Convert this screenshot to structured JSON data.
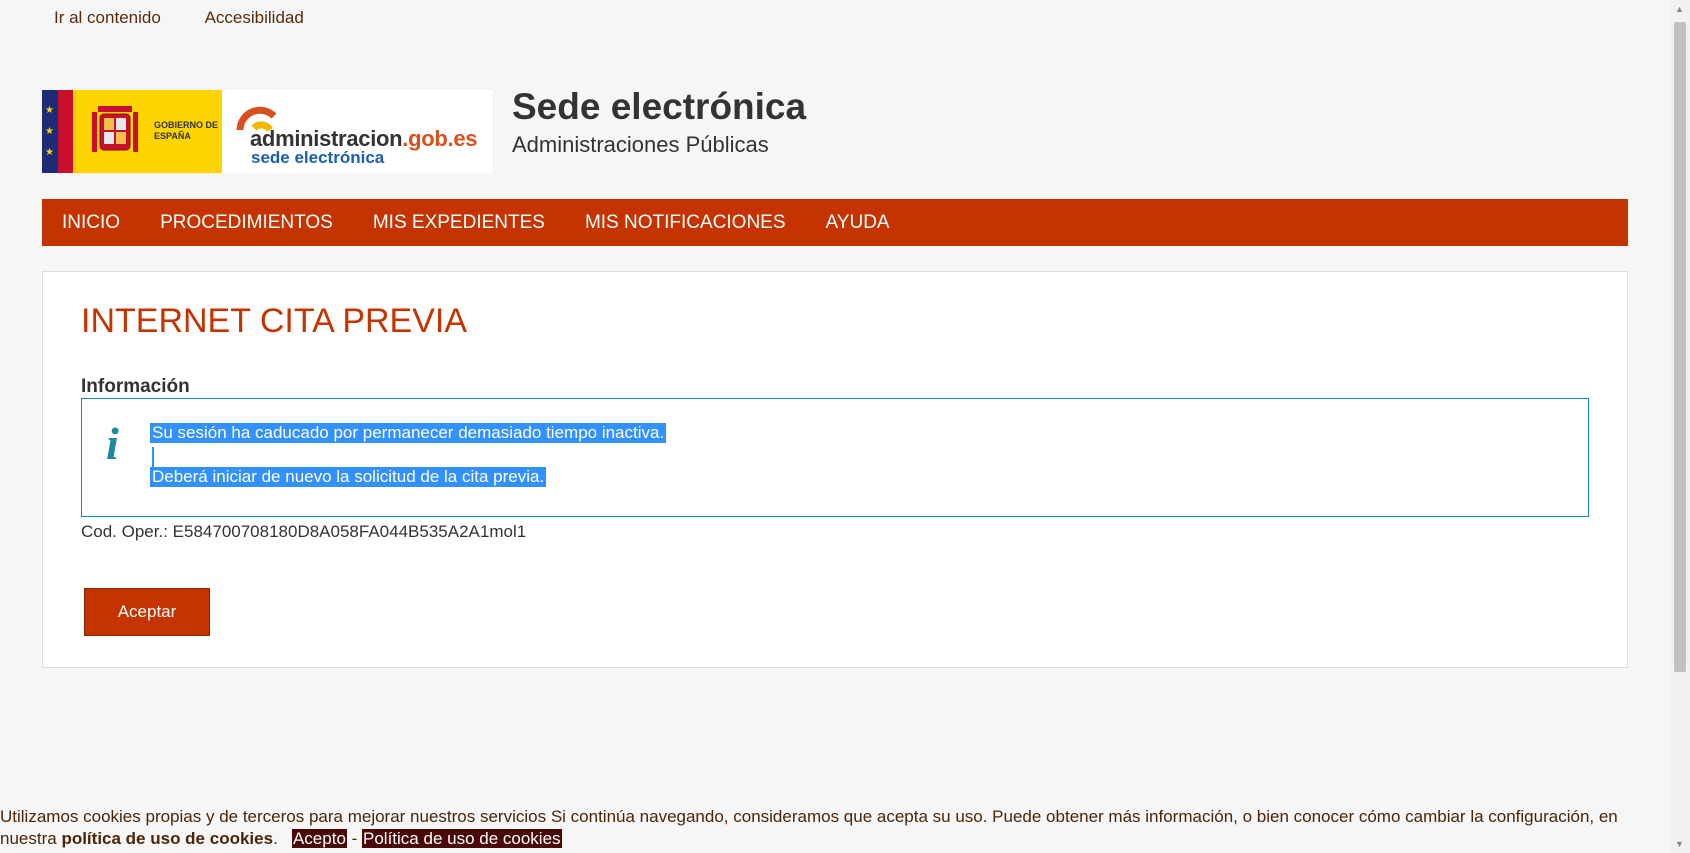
{
  "skip_links": {
    "content": "Ir al contenido",
    "accessibility": "Accesibilidad"
  },
  "header": {
    "gobierno_logo": "GOBIERNO DE ESPAÑA",
    "admin_logo_main": "administracion",
    "admin_logo_domain": ".gob.es",
    "admin_logo_sub": "sede electrónica",
    "title": "Sede electrónica",
    "subtitle": "Administraciones Públicas"
  },
  "nav": {
    "items": [
      "INICIO",
      "PROCEDIMIENTOS",
      "MIS EXPEDIENTES",
      "MIS NOTIFICACIONES",
      "AYUDA"
    ]
  },
  "main": {
    "page_title": "INTERNET CITA PREVIA",
    "info_label": "Información",
    "info_icon": "info-icon",
    "messages": [
      "Su sesión ha caducado por permanecer demasiado tiempo inactiva.",
      "Deberá iniciar de nuevo la solicitud de la cita previa."
    ],
    "cod_oper": "Cod. Oper.: E584700708180D8A058FA044B535A2A1mol1",
    "accept_button": "Aceptar"
  },
  "cookie_bar": {
    "text": "Utilizamos cookies propias y de terceros para mejorar nuestros servicios Si continúa navegando, consideramos que acepta su uso. Puede obtener más información, o bien conocer cómo cambiar la configuración, en nuestra ",
    "policy_bold": "política de uso de cookies",
    "period": ".",
    "accept": "Acepto",
    "separator": " - ",
    "policy_link": "Política de uso de cookies"
  },
  "colors": {
    "brand_red": "#c53300",
    "info_teal": "#1a8a9e",
    "selection_blue": "#3390ff"
  }
}
